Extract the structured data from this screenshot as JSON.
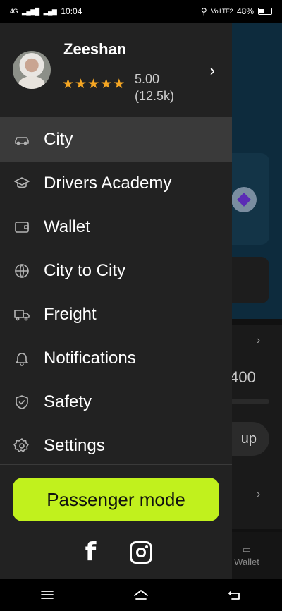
{
  "status_bar": {
    "network_left": "4G",
    "time": "10:04",
    "network_right": "Vo LTE2",
    "battery": "48%"
  },
  "profile": {
    "name": "Zeeshan",
    "rating": "5.00",
    "rating_count": "(12.5k)",
    "stars": 5
  },
  "menu": [
    {
      "label": "City",
      "icon": "car-icon",
      "active": true
    },
    {
      "label": "Drivers Academy",
      "icon": "graduation-cap-icon"
    },
    {
      "label": "Wallet",
      "icon": "wallet-icon"
    },
    {
      "label": "City to City",
      "icon": "globe-icon"
    },
    {
      "label": "Freight",
      "icon": "truck-icon"
    },
    {
      "label": "Notifications",
      "icon": "bell-icon"
    },
    {
      "label": "Safety",
      "icon": "shield-icon"
    },
    {
      "label": "Settings",
      "icon": "gear-icon"
    }
  ],
  "passenger_button": "Passenger mode",
  "social": [
    "facebook-icon",
    "instagram-icon"
  ],
  "background": {
    "amount": ",400",
    "pill_text": "up",
    "nav_label": "Wallet"
  },
  "colors": {
    "accent": "#c1f11d",
    "drawer": "#222222",
    "star": "#f5a623"
  }
}
